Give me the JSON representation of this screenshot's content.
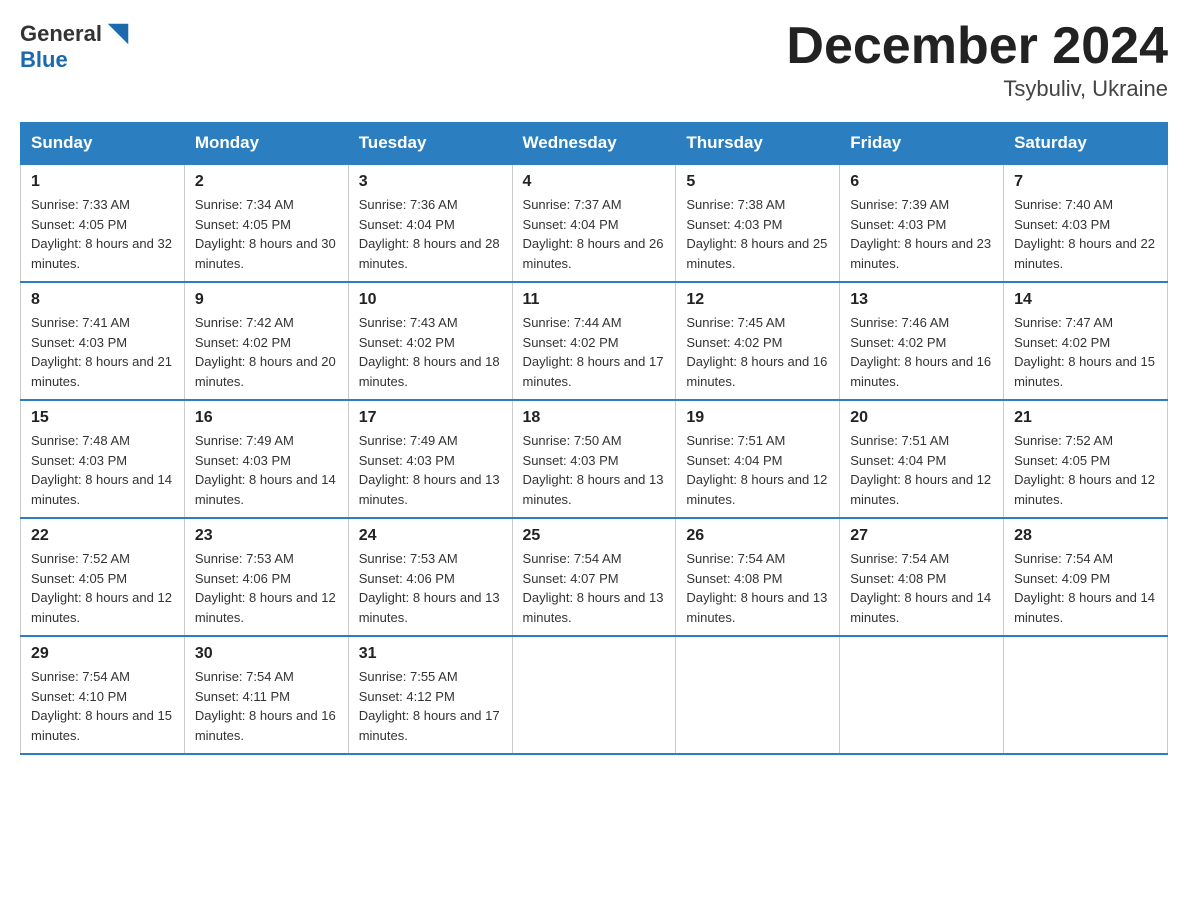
{
  "header": {
    "logo_general": "General",
    "logo_blue": "Blue",
    "month_title": "December 2024",
    "location": "Tsybuliv, Ukraine"
  },
  "days_of_week": [
    "Sunday",
    "Monday",
    "Tuesday",
    "Wednesday",
    "Thursday",
    "Friday",
    "Saturday"
  ],
  "weeks": [
    [
      {
        "day": "1",
        "sunrise": "7:33 AM",
        "sunset": "4:05 PM",
        "daylight": "8 hours and 32 minutes."
      },
      {
        "day": "2",
        "sunrise": "7:34 AM",
        "sunset": "4:05 PM",
        "daylight": "8 hours and 30 minutes."
      },
      {
        "day": "3",
        "sunrise": "7:36 AM",
        "sunset": "4:04 PM",
        "daylight": "8 hours and 28 minutes."
      },
      {
        "day": "4",
        "sunrise": "7:37 AM",
        "sunset": "4:04 PM",
        "daylight": "8 hours and 26 minutes."
      },
      {
        "day": "5",
        "sunrise": "7:38 AM",
        "sunset": "4:03 PM",
        "daylight": "8 hours and 25 minutes."
      },
      {
        "day": "6",
        "sunrise": "7:39 AM",
        "sunset": "4:03 PM",
        "daylight": "8 hours and 23 minutes."
      },
      {
        "day": "7",
        "sunrise": "7:40 AM",
        "sunset": "4:03 PM",
        "daylight": "8 hours and 22 minutes."
      }
    ],
    [
      {
        "day": "8",
        "sunrise": "7:41 AM",
        "sunset": "4:03 PM",
        "daylight": "8 hours and 21 minutes."
      },
      {
        "day": "9",
        "sunrise": "7:42 AM",
        "sunset": "4:02 PM",
        "daylight": "8 hours and 20 minutes."
      },
      {
        "day": "10",
        "sunrise": "7:43 AM",
        "sunset": "4:02 PM",
        "daylight": "8 hours and 18 minutes."
      },
      {
        "day": "11",
        "sunrise": "7:44 AM",
        "sunset": "4:02 PM",
        "daylight": "8 hours and 17 minutes."
      },
      {
        "day": "12",
        "sunrise": "7:45 AM",
        "sunset": "4:02 PM",
        "daylight": "8 hours and 16 minutes."
      },
      {
        "day": "13",
        "sunrise": "7:46 AM",
        "sunset": "4:02 PM",
        "daylight": "8 hours and 16 minutes."
      },
      {
        "day": "14",
        "sunrise": "7:47 AM",
        "sunset": "4:02 PM",
        "daylight": "8 hours and 15 minutes."
      }
    ],
    [
      {
        "day": "15",
        "sunrise": "7:48 AM",
        "sunset": "4:03 PM",
        "daylight": "8 hours and 14 minutes."
      },
      {
        "day": "16",
        "sunrise": "7:49 AM",
        "sunset": "4:03 PM",
        "daylight": "8 hours and 14 minutes."
      },
      {
        "day": "17",
        "sunrise": "7:49 AM",
        "sunset": "4:03 PM",
        "daylight": "8 hours and 13 minutes."
      },
      {
        "day": "18",
        "sunrise": "7:50 AM",
        "sunset": "4:03 PM",
        "daylight": "8 hours and 13 minutes."
      },
      {
        "day": "19",
        "sunrise": "7:51 AM",
        "sunset": "4:04 PM",
        "daylight": "8 hours and 12 minutes."
      },
      {
        "day": "20",
        "sunrise": "7:51 AM",
        "sunset": "4:04 PM",
        "daylight": "8 hours and 12 minutes."
      },
      {
        "day": "21",
        "sunrise": "7:52 AM",
        "sunset": "4:05 PM",
        "daylight": "8 hours and 12 minutes."
      }
    ],
    [
      {
        "day": "22",
        "sunrise": "7:52 AM",
        "sunset": "4:05 PM",
        "daylight": "8 hours and 12 minutes."
      },
      {
        "day": "23",
        "sunrise": "7:53 AM",
        "sunset": "4:06 PM",
        "daylight": "8 hours and 12 minutes."
      },
      {
        "day": "24",
        "sunrise": "7:53 AM",
        "sunset": "4:06 PM",
        "daylight": "8 hours and 13 minutes."
      },
      {
        "day": "25",
        "sunrise": "7:54 AM",
        "sunset": "4:07 PM",
        "daylight": "8 hours and 13 minutes."
      },
      {
        "day": "26",
        "sunrise": "7:54 AM",
        "sunset": "4:08 PM",
        "daylight": "8 hours and 13 minutes."
      },
      {
        "day": "27",
        "sunrise": "7:54 AM",
        "sunset": "4:08 PM",
        "daylight": "8 hours and 14 minutes."
      },
      {
        "day": "28",
        "sunrise": "7:54 AM",
        "sunset": "4:09 PM",
        "daylight": "8 hours and 14 minutes."
      }
    ],
    [
      {
        "day": "29",
        "sunrise": "7:54 AM",
        "sunset": "4:10 PM",
        "daylight": "8 hours and 15 minutes."
      },
      {
        "day": "30",
        "sunrise": "7:54 AM",
        "sunset": "4:11 PM",
        "daylight": "8 hours and 16 minutes."
      },
      {
        "day": "31",
        "sunrise": "7:55 AM",
        "sunset": "4:12 PM",
        "daylight": "8 hours and 17 minutes."
      },
      null,
      null,
      null,
      null
    ]
  ]
}
